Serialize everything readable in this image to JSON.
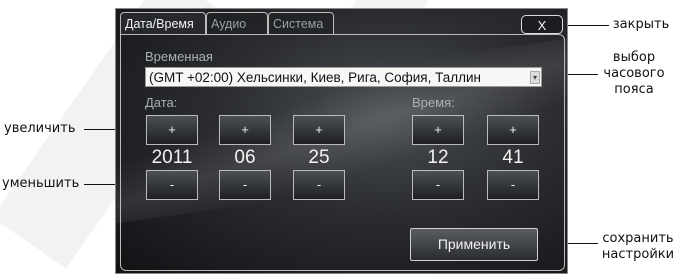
{
  "tabs": [
    {
      "label": "Дата/Время"
    },
    {
      "label": "Аудио"
    },
    {
      "label": "Система"
    }
  ],
  "close_label": "X",
  "timezone": {
    "label": "Временная",
    "value": "(GMT +02:00) Хельсинки, Киев, Рига, София, Таллин"
  },
  "date": {
    "label": "Дата:",
    "year": "2011",
    "month": "06",
    "day": "25"
  },
  "time": {
    "label": "Время:",
    "hour": "12",
    "minute": "41"
  },
  "increment_label": "+",
  "decrement_label": "-",
  "apply_label": "Применить",
  "annotations": {
    "close": "закрыть",
    "timezone_select": "выбор часового пояса",
    "increase": "увеличить",
    "decrease": "уменьшить",
    "save": "сохранить настройки"
  }
}
